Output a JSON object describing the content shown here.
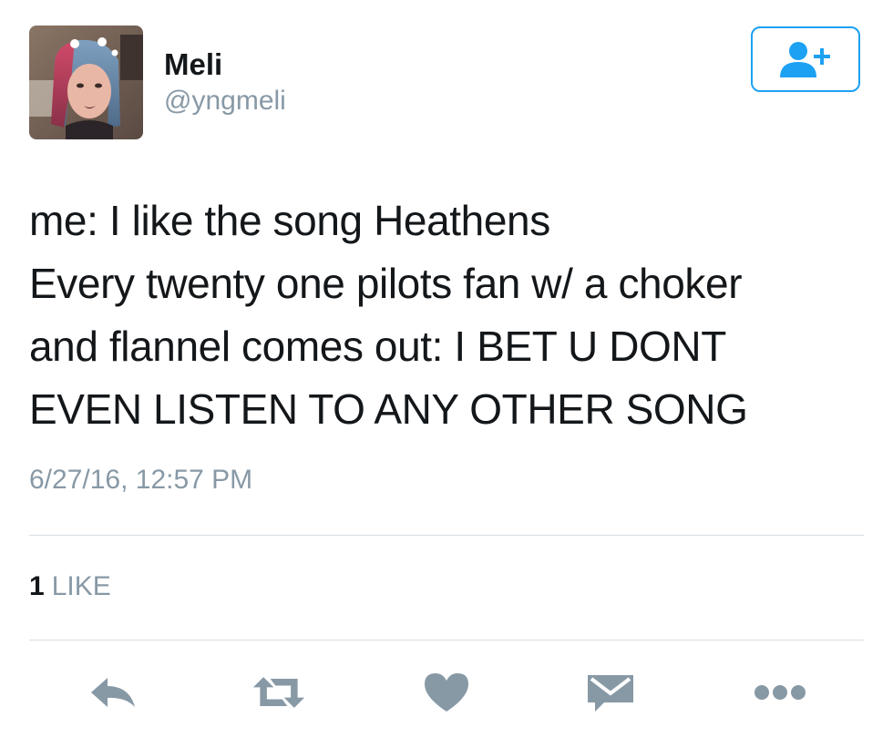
{
  "user": {
    "display_name": "Meli",
    "handle": "@yngmeli"
  },
  "follow_button": {
    "icon": "add-user-icon",
    "color": "#1da1f2"
  },
  "tweet": {
    "lines": [
      "me: I like the song Heathens",
      "Every twenty one pilots fan w/ a choker",
      "and flannel comes out: I BET U DONT",
      "EVEN LISTEN TO ANY OTHER SONG"
    ],
    "timestamp": "6/27/16, 12:57 PM"
  },
  "stats": {
    "likes_count": "1",
    "likes_label": "LIKE"
  },
  "actions": [
    {
      "icon": "reply-icon"
    },
    {
      "icon": "retweet-icon"
    },
    {
      "icon": "heart-icon"
    },
    {
      "icon": "direct-message-icon"
    },
    {
      "icon": "more-icon"
    }
  ],
  "colors": {
    "text": "#14171a",
    "secondary": "#8899a6",
    "accent": "#1da1f2",
    "divider": "#d8dee3"
  }
}
